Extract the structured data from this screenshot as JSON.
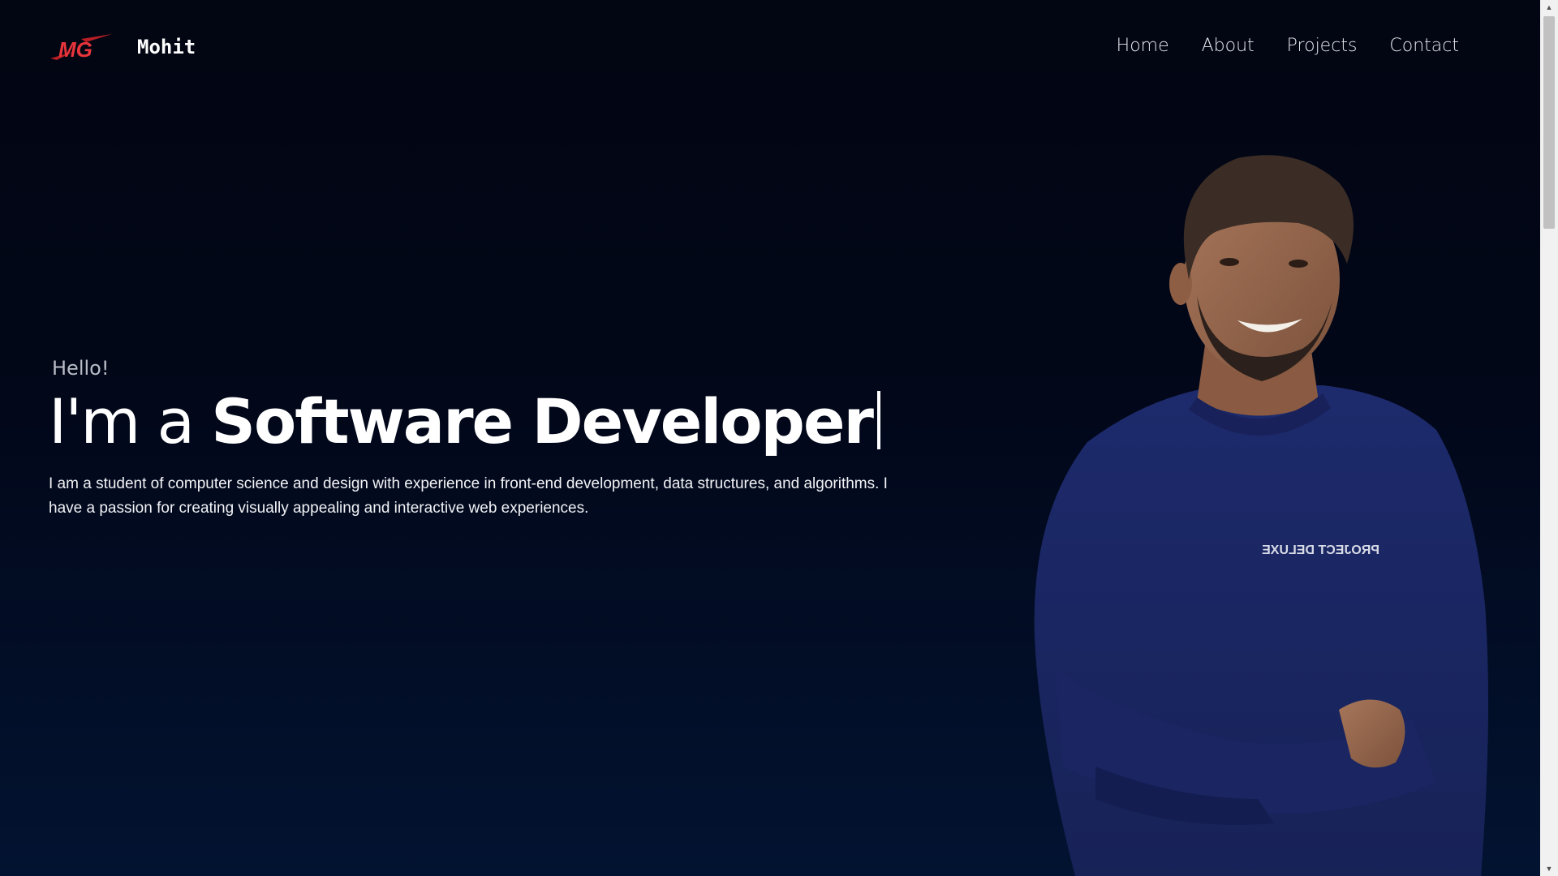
{
  "header": {
    "brand_name": "Mohit",
    "logo_text": "MG",
    "nav": [
      {
        "label": "Home"
      },
      {
        "label": "About"
      },
      {
        "label": "Projects"
      },
      {
        "label": "Contact"
      }
    ]
  },
  "hero": {
    "greeting": "Hello!",
    "headline_prefix": "I'm a ",
    "headline_role": "Software Developer",
    "intro": "I am a student of computer science and design with experience in front-end development, data structures, and algorithms. I have a passion for creating visually appealing and interactive web experiences.",
    "shirt_print": "PROJECT DELUXE"
  },
  "colors": {
    "background_top": "#020612",
    "background_bottom": "#021331",
    "logo_red": "#e8353b",
    "text_primary": "#ffffff",
    "text_muted": "#b9bcc6"
  },
  "icons": {
    "logo": "mg-logo-icon",
    "scroll_up": "scroll-up-arrow-icon",
    "scroll_down": "scroll-down-arrow-icon"
  }
}
